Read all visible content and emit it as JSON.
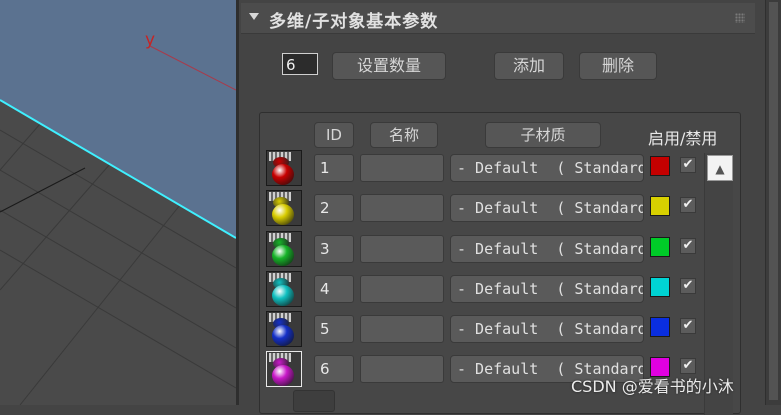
{
  "viewport": {
    "axis_label": "y"
  },
  "rollout": {
    "title": "多维/子对象基本参数"
  },
  "controls": {
    "count_value": "6",
    "set_count_label": "设置数量",
    "add_label": "添加",
    "delete_label": "删除"
  },
  "table": {
    "headers": {
      "id": "ID",
      "name": "名称",
      "submaterial": "子材质",
      "enable": "启用/禁用"
    },
    "rows": [
      {
        "id": "1",
        "name": "",
        "material": "- Default  ( Standard )",
        "color": "#c40000",
        "sphere_color": "#c80000",
        "enabled": "✔"
      },
      {
        "id": "2",
        "name": "",
        "material": "- Default  ( Standard )",
        "color": "#d8d000",
        "sphere_color": "#d8cc00",
        "enabled": "✔"
      },
      {
        "id": "3",
        "name": "",
        "material": "- Default  ( Standard )",
        "color": "#00cc28",
        "sphere_color": "#16b428",
        "enabled": "✔"
      },
      {
        "id": "4",
        "name": "",
        "material": "- Default  ( Standard )",
        "color": "#00d4d4",
        "sphere_color": "#10c0c0",
        "enabled": "✔"
      },
      {
        "id": "5",
        "name": "",
        "material": "- Default  ( Standard )",
        "color": "#0a2ee0",
        "sphere_color": "#1430c8",
        "enabled": "✔"
      },
      {
        "id": "6",
        "name": "",
        "material": "- Default  ( Standard )",
        "color": "#e000e0",
        "sphere_color": "#c818c8",
        "enabled": "✔"
      }
    ],
    "scroll_up_icon": "▲"
  },
  "watermark": "CSDN @爱看书的小沐"
}
